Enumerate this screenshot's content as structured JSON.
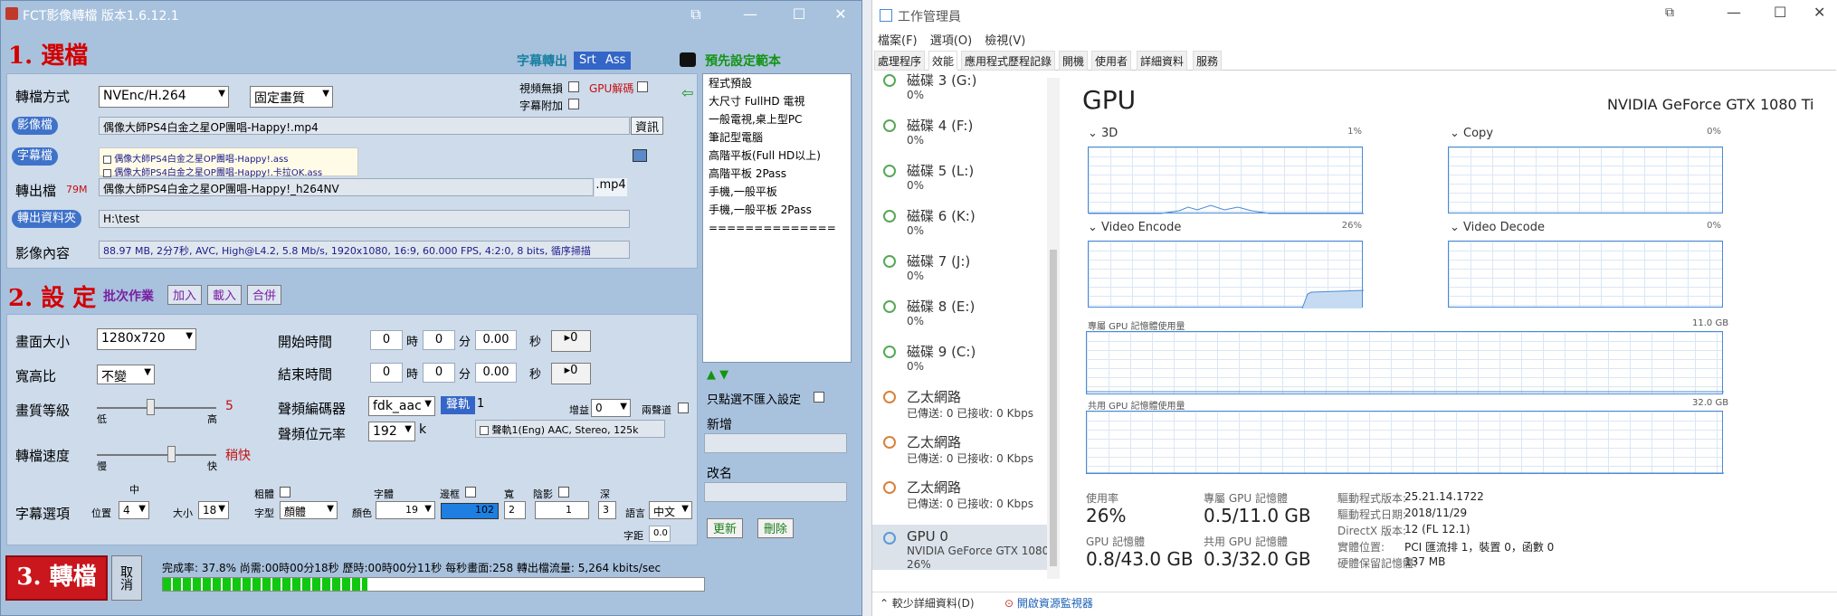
{
  "fct": {
    "title": "FCT影像轉檔 版本1.6.12.1",
    "section1": "1. 選檔",
    "subtitle_convert": "字幕轉出",
    "srt": "Srt",
    "ass": "Ass",
    "preset_title": "預先設定範本",
    "convert_mode_label": "轉檔方式",
    "convert_mode_value": "NVEnc/H.264",
    "quality_mode_value": "固定畫質",
    "video_no_loss": "視頻無損",
    "gpu_decode": "GPU解碼",
    "subtitle_attach": "字幕附加",
    "video_file_label": "影像檔",
    "video_file_value": "偶像大師PS4白金之星OP團唱-Happy!.mp4",
    "info_button": "資訊",
    "subtitle_file_label": "字幕檔",
    "subtitle_files": [
      "偶像大師PS4白金之星OP團唱-Happy!.ass",
      "偶像大師PS4白金之星OP團唱-Happy!.卡拉OK.ass"
    ],
    "output_file_label": "轉出檔",
    "output_size": "79M",
    "output_file_value": "偶像大師PS4白金之星OP團唱-Happy!_h264NV",
    "output_ext": ".mp4",
    "output_folder_label": "轉出資料夾",
    "output_folder_value": "H:\\test",
    "media_info_label": "影像內容",
    "media_info_value": "88.97 MB, 2分7秒, AVC, High@L4.2, 5.8 Mb/s, 1920x1080, 16:9, 60.000 FPS, 4:2:0, 8 bits, 循序掃描",
    "section2": "2. 設 定",
    "batch": "批次作業",
    "add": "加入",
    "load": "載入",
    "merge": "合併",
    "size_label": "畫面大小",
    "size_value": "1280x720",
    "aspect_label": "寬高比",
    "aspect_value": "不變",
    "quality_label": "畫質等級",
    "quality_low": "低",
    "quality_high": "高",
    "quality_value": "5",
    "speed_label": "轉檔速度",
    "speed_slow": "慢",
    "speed_fast": "快",
    "speed_value": "稍快",
    "start_label": "開始時間",
    "end_label": "結束時間",
    "hour": "時",
    "minute": "分",
    "second": "秒",
    "zero": "0",
    "sec_zero": "0.00",
    "reset_btn": "▸0",
    "audio_codec_label": "聲頻編碼器",
    "audio_codec_value": "fdk_aac",
    "audio_track": "聲軌",
    "audio_track_num": "1",
    "gain_label": "增益",
    "gain_value": "0",
    "dual_channel": "兩聲道",
    "audio_bitrate_label": "聲頻位元率",
    "audio_bitrate_value": "192",
    "k": "k",
    "audio_track_info": "聲軌1(Eng) AAC, Stereo, 125k",
    "sub_options_label": "字幕選項",
    "mid": "中",
    "position_label": "位置",
    "position_value": "4",
    "size_small_label": "大小",
    "size_small_value": "18",
    "bold_label": "粗體",
    "font_label": "字型",
    "font_value": "顏體",
    "sub_title": "字體",
    "color_label": "顏色",
    "color_value": "19",
    "border_label": "邊框",
    "border_value": "102",
    "width_label": "寬",
    "width_value": "2",
    "shadow_label": "陰影",
    "shadow_value": "1",
    "depth_label": "深",
    "depth_value": "3",
    "lang_label": "語言",
    "lang_value": "中文",
    "spacing_label": "字距",
    "spacing_value": "0.0",
    "only_preset": "只點選不匯入設定",
    "new_label": "新增",
    "rename_label": "改名",
    "update_btn": "更新",
    "delete_btn": "刪除",
    "convert_btn": "3. 轉檔",
    "cancel_btn": "取消",
    "progress_text": "完成率: 37.8% 尚需:00時00分18秒 歷時:00時00分11秒 每秒畫面:258 轉出檔流量: 5,264 kbits/sec",
    "progress_pct": 0.378,
    "presets": [
      "程式預設",
      "大尺寸 FullHD 電視",
      "一般電視,桌上型PC",
      "筆記型電腦",
      "高階平板(Full HD以上)",
      "高階平板 2Pass",
      "手機,一般平板",
      "手機,一般平板  2Pass",
      "=============="
    ]
  },
  "tm": {
    "title": "工作管理員",
    "menu": [
      "檔案(F)",
      "選項(O)",
      "檢視(V)"
    ],
    "tabs": [
      "處理程序",
      "效能",
      "應用程式歷程記錄",
      "開機",
      "使用者",
      "詳細資料",
      "服務"
    ],
    "sidebar": [
      {
        "name": "磁碟 3 (G:)",
        "sub": "0%",
        "kind": "disk"
      },
      {
        "name": "磁碟 4 (F:)",
        "sub": "0%",
        "kind": "disk"
      },
      {
        "name": "磁碟 5 (L:)",
        "sub": "0%",
        "kind": "disk"
      },
      {
        "name": "磁碟 6 (K:)",
        "sub": "0%",
        "kind": "disk"
      },
      {
        "name": "磁碟 7 (J:)",
        "sub": "0%",
        "kind": "disk"
      },
      {
        "name": "磁碟 8 (E:)",
        "sub": "0%",
        "kind": "disk"
      },
      {
        "name": "磁碟 9 (C:)",
        "sub": "0%",
        "kind": "disk"
      },
      {
        "name": "乙太網路",
        "sub": "已傳送: 0 已接收: 0 Kbps",
        "kind": "net"
      },
      {
        "name": "乙太網路",
        "sub": "已傳送: 0 已接收: 0 Kbps",
        "kind": "net"
      },
      {
        "name": "乙太網路",
        "sub": "已傳送: 0 已接收: 0 Kbps",
        "kind": "net"
      }
    ],
    "gpu_item": {
      "name": "GPU 0",
      "sub": "NVIDIA GeForce GTX 1080",
      "pct": "26%"
    },
    "gpu_heading": "GPU",
    "gpu_model": "NVIDIA GeForce GTX 1080 Ti",
    "graphs": [
      {
        "label": "3D",
        "pct": "1%"
      },
      {
        "label": "Copy",
        "pct": "0%"
      },
      {
        "label": "Video Encode",
        "pct": "26%"
      },
      {
        "label": "Video Decode",
        "pct": "0%"
      }
    ],
    "dedicated_label": "專屬 GPU 記憶體使用量",
    "dedicated_max": "11.0 GB",
    "shared_label": "共用 GPU 記憶體使用量",
    "shared_max": "32.0 GB",
    "usage_label": "使用率",
    "usage_value": "26%",
    "ded_mem_label": "專屬 GPU 記憶體",
    "ded_mem_value": "0.5/11.0 GB",
    "gpu_mem_label": "GPU 記憶體",
    "gpu_mem_value": "0.8/43.0 GB",
    "shared_mem_label": "共用 GPU 記憶體",
    "shared_mem_value": "0.3/32.0 GB",
    "details": [
      {
        "k": "驅動程式版本:",
        "v": "25.21.14.1722"
      },
      {
        "k": "驅動程式日期:",
        "v": "2018/11/29"
      },
      {
        "k": "DirectX 版本:",
        "v": "12 (FL 12.1)"
      },
      {
        "k": "實體位置:",
        "v": "PCI 匯流排 1，裝置 0，函數 0"
      },
      {
        "k": "硬體保留記憶體:",
        "v": "137 MB"
      }
    ],
    "fewer_details": "較少詳細資料(D)",
    "open_monitor": "開啟資源監視器"
  }
}
